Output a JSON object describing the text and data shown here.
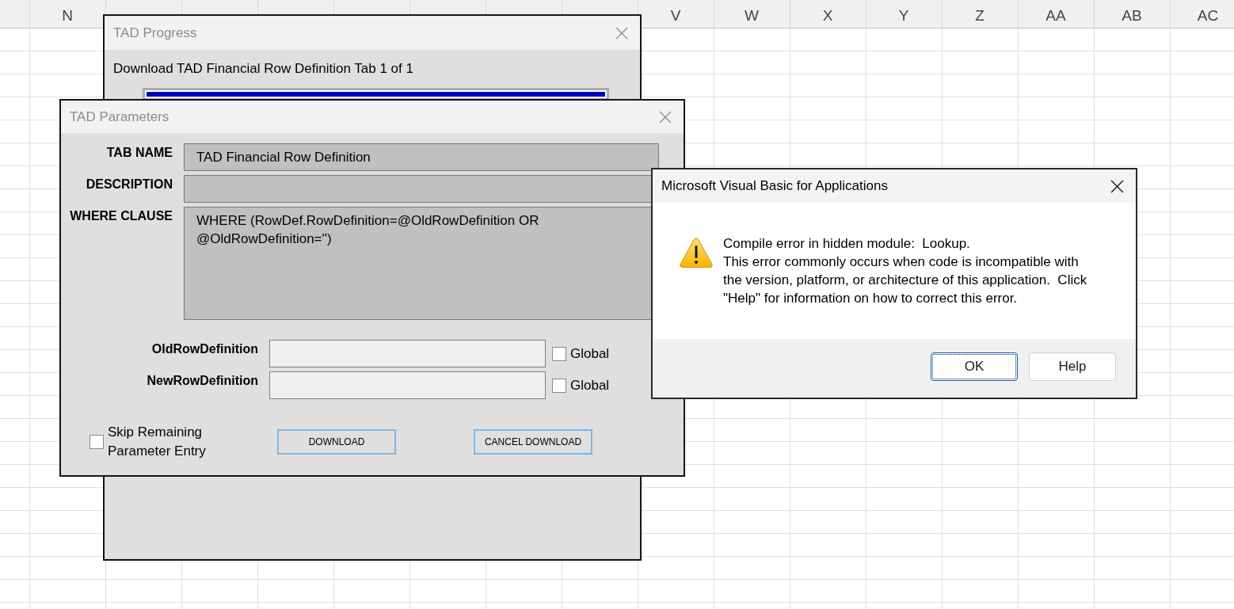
{
  "sheet": {
    "column_headers_left": [
      "N"
    ],
    "column_headers_right": [
      "V",
      "W",
      "X",
      "Y",
      "Z",
      "AA",
      "AB",
      "AC"
    ]
  },
  "progress_dialog": {
    "title": "TAD Progress",
    "active": false,
    "message": "Download TAD Financial Row Definition Tab 1 of 1",
    "progress": {
      "level": 1
    }
  },
  "parameters_dialog": {
    "title": "TAD Parameters",
    "active": false,
    "fields": [
      {
        "label": "TAB NAME",
        "kind": "line",
        "value": "TAD Financial Row Definition"
      },
      {
        "label": "DESCRIPTION",
        "kind": "line"
      },
      {
        "label": "WHERE CLAUSE",
        "kind": "multiline",
        "value": "WHERE (RowDef.RowDefinition=@OldRowDefinition OR @OldRowDefinition='')"
      }
    ],
    "definitions": [
      {
        "label": "OldRowDefinition",
        "global": {
          "label": "Global",
          "checked": false
        }
      },
      {
        "label": "NewRowDefinition",
        "global": {
          "label": "Global",
          "checked": false
        }
      }
    ],
    "skip": {
      "label": "Skip Remaining Parameter Entry",
      "checked": false
    },
    "buttons": [
      "DOWNLOAD",
      "CANCEL DOWNLOAD"
    ]
  },
  "error_dialog": {
    "title": "Microsoft Visual Basic for Applications",
    "active": true,
    "message": [
      "Compile error in hidden module:  Lookup.",
      "This error commonly occurs when code is incompatible with the version, platform, or architecture of this application.  Click \"Help\" for information on how to correct this error."
    ],
    "buttons": [
      {
        "label": "OK",
        "focused": true
      },
      {
        "label": "Help",
        "focused": false
      }
    ]
  }
}
